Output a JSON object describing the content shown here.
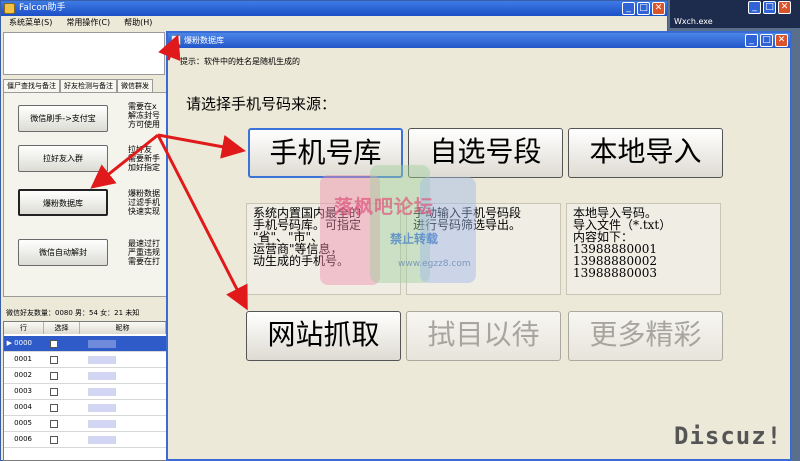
{
  "back_window": {
    "title": "Falcon助手",
    "menu": [
      "系统菜单(S)",
      "常用操作(C)",
      "帮助(H)"
    ],
    "tabs": [
      "僵尸查找与备注",
      "好友检测与备注",
      "微信群发"
    ],
    "side_buttons": [
      "微信刷手->支付宝",
      "拉好友入群",
      "爆粉数据库",
      "微信自动解封"
    ],
    "side_desc": [
      [
        "需要在x",
        "解冻封号",
        "方可使用"
      ],
      [
        "拉好友",
        "需要新手",
        "加好指定"
      ],
      [
        "爆粉数据",
        "过滤手机",
        "快速实现"
      ],
      [
        "最速过打",
        "严重违规",
        "需要在打"
      ]
    ],
    "stats": "微信好友数量：0080  男：54  女：21  未知",
    "grid": {
      "headers": [
        "行",
        "选择",
        "昵称"
      ],
      "rows": [
        "0000",
        "0001",
        "0002",
        "0003",
        "0004",
        "0005",
        "0006"
      ],
      "selected_row": "0000"
    },
    "tray_text": "Wxch.exe"
  },
  "dialog": {
    "title": "爆粉数据库",
    "hint": "提示：软件中的姓名是随机生成的",
    "heading": "请选择手机号码来源：",
    "buttons": {
      "phone_library": "手机号库",
      "custom_segment": "自选号段",
      "local_import": "本地导入",
      "web_scrape": "网站抓取",
      "coming_soon": "拭目以待",
      "more": "更多精彩"
    },
    "descriptions": {
      "phone_library": [
        "系统内置国内最全的",
        "手机号码库。可指定",
        "\"省\"、\"市\"、",
        "运营商\"等信息，",
        "动生成的手机号。"
      ],
      "custom_segment": [
        "手动输入手机号码段",
        "进行号码筛选导出。"
      ],
      "local_import": [
        "本地导入号码。",
        "导入文件（*.txt）",
        "内容如下：",
        "13988880001",
        "13988880002",
        "13988880003"
      ]
    }
  },
  "watermark": {
    "line1": "落枫吧论坛",
    "line2": "禁止转载",
    "line3": "www.egzz8.com"
  },
  "discuz_mark": "Discuz!",
  "colors": {
    "titlebar": "#2356c9",
    "arrow": "#e01a1a",
    "selection": "#2e5bc7"
  }
}
